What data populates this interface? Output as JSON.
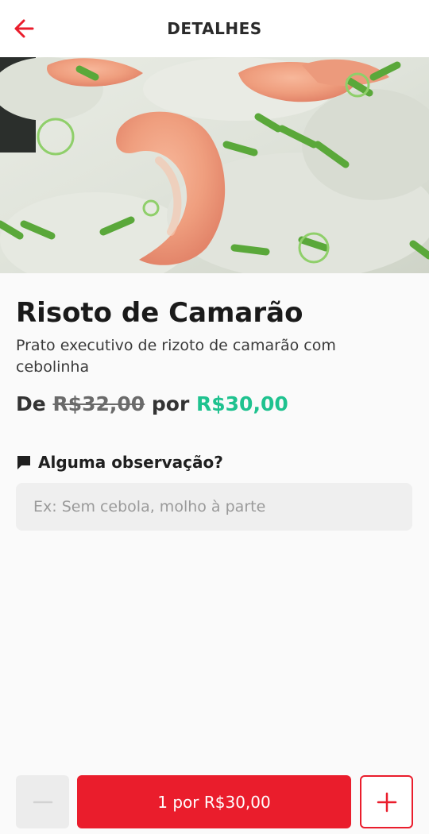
{
  "header": {
    "title": "DETALHES",
    "back_icon": "arrow-left-icon"
  },
  "hero": {
    "image_subject": "shrimp risotto with green onions"
  },
  "item": {
    "name": "Risoto de Camarão",
    "description": "Prato executivo de rizoto de camarão com cebolinha",
    "price_prefix": "De",
    "old_price": "R$32,00",
    "price_connector": "por",
    "new_price": "R$30,00"
  },
  "observation": {
    "icon": "comment-icon",
    "label": "Alguma observação?",
    "placeholder": "Ex: Sem cebola, molho à parte",
    "value": ""
  },
  "footer": {
    "minus_icon": "minus-icon",
    "add_label": "1 por R$30,00",
    "plus_icon": "plus-icon"
  },
  "colors": {
    "accent": "#ea1d2c",
    "new_price": "#1fc28f",
    "old_price": "#6a6a6a"
  }
}
